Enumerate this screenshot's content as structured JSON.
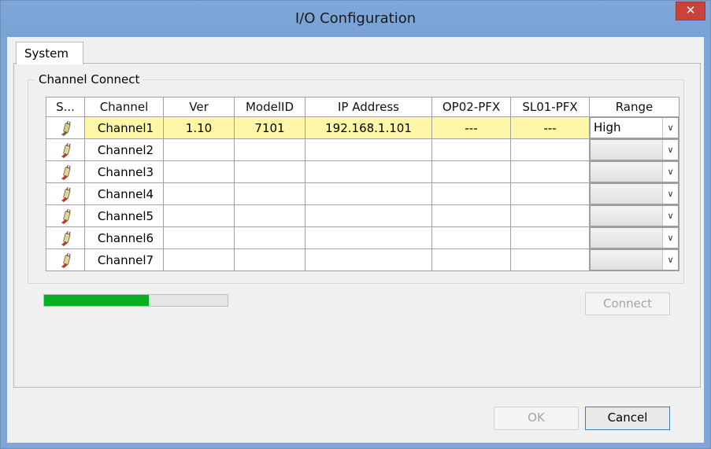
{
  "window": {
    "title": "I/O Configuration",
    "close_glyph": "✕"
  },
  "tabs": [
    {
      "label": "System",
      "active": true
    }
  ],
  "group": {
    "label": "Channel Connect"
  },
  "table": {
    "columns": [
      "S...",
      "Channel",
      "Ver",
      "ModelID",
      "IP Address",
      "OP02-PFX",
      "SL01-PFX",
      "Range"
    ],
    "rows": [
      {
        "status_icon": "plug-connected-icon",
        "channel": "Channel1",
        "ver": "1.10",
        "model_id": "7101",
        "ip": "192.168.1.101",
        "op02": "---",
        "sl01": "---",
        "range": "High",
        "selected": true
      },
      {
        "status_icon": "plug-disconnected-icon",
        "channel": "Channel2",
        "ver": "",
        "model_id": "",
        "ip": "",
        "op02": "",
        "sl01": "",
        "range": "",
        "selected": false
      },
      {
        "status_icon": "plug-disconnected-icon",
        "channel": "Channel3",
        "ver": "",
        "model_id": "",
        "ip": "",
        "op02": "",
        "sl01": "",
        "range": "",
        "selected": false
      },
      {
        "status_icon": "plug-disconnected-icon",
        "channel": "Channel4",
        "ver": "",
        "model_id": "",
        "ip": "",
        "op02": "",
        "sl01": "",
        "range": "",
        "selected": false
      },
      {
        "status_icon": "plug-disconnected-icon",
        "channel": "Channel5",
        "ver": "",
        "model_id": "",
        "ip": "",
        "op02": "",
        "sl01": "",
        "range": "",
        "selected": false
      },
      {
        "status_icon": "plug-disconnected-icon",
        "channel": "Channel6",
        "ver": "",
        "model_id": "",
        "ip": "",
        "op02": "",
        "sl01": "",
        "range": "",
        "selected": false
      },
      {
        "status_icon": "plug-disconnected-icon",
        "channel": "Channel7",
        "ver": "",
        "model_id": "",
        "ip": "",
        "op02": "",
        "sl01": "",
        "range": "",
        "selected": false
      }
    ]
  },
  "progress": {
    "fraction": 0.57
  },
  "buttons": {
    "connect": "Connect",
    "ok": "OK",
    "cancel": "Cancel"
  },
  "colors": {
    "progress_fill": "#06b025",
    "selected_row": "#fff7a8",
    "titlebar": "#7ea6d6",
    "close_button": "#c7433c"
  }
}
